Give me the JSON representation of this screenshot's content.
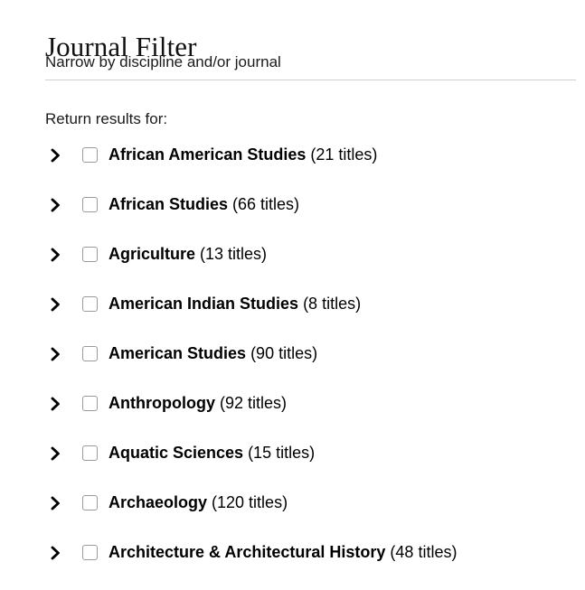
{
  "header": {
    "title": "Journal Filter",
    "subtitle": "Narrow by discipline and/or journal"
  },
  "filter": {
    "return_label": "Return results for:",
    "expand_icon": "chevron-right-icon",
    "checkbox_state": "unchecked",
    "items": [
      {
        "name": "African American Studies",
        "count": "(21 titles)"
      },
      {
        "name": "African Studies",
        "count": "(66 titles)"
      },
      {
        "name": "Agriculture",
        "count": "(13 titles)"
      },
      {
        "name": "American Indian Studies",
        "count": "(8 titles)"
      },
      {
        "name": "American Studies",
        "count": "(90 titles)"
      },
      {
        "name": "Anthropology",
        "count": "(92 titles)"
      },
      {
        "name": "Aquatic Sciences",
        "count": "(15 titles)"
      },
      {
        "name": "Archaeology",
        "count": "(120 titles)"
      },
      {
        "name": "Architecture & Architectural History",
        "count": "(48 titles)"
      }
    ]
  },
  "colors": {
    "background": "#ffffff",
    "text": "#000000",
    "divider": "#cfcfcf",
    "checkbox_border": "#9a9a9a"
  }
}
